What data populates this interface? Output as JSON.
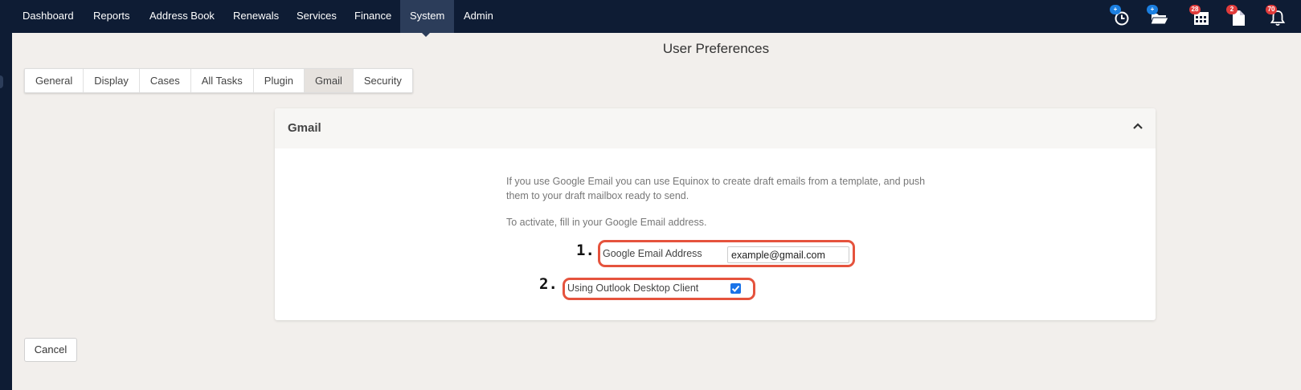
{
  "nav": {
    "items": [
      "Dashboard",
      "Reports",
      "Address Book",
      "Renewals",
      "Services",
      "Finance",
      "System",
      "Admin"
    ],
    "active": "System",
    "icons": [
      {
        "name": "add-timer-icon",
        "badge": "+",
        "badge_color": "#1b7fe0"
      },
      {
        "name": "add-folder-icon",
        "badge": "+",
        "badge_color": "#1b7fe0"
      },
      {
        "name": "calendar-icon",
        "badge": "28",
        "badge_color": "#e03b3b"
      },
      {
        "name": "document-icon",
        "badge": "2",
        "badge_color": "#e03b3b"
      },
      {
        "name": "bell-icon",
        "badge": "70",
        "badge_color": "#e03b3b"
      }
    ]
  },
  "page": {
    "title": "User Preferences"
  },
  "tabs": [
    "General",
    "Display",
    "Cases",
    "All Tasks",
    "Plugin",
    "Gmail",
    "Security"
  ],
  "active_tab": "Gmail",
  "panel": {
    "title": "Gmail",
    "description": "If you use Google Email you can use Equinox to create draft emails from a template, and push them to your draft mailbox ready to send.",
    "activate_text": "To activate, fill in your Google Email address.",
    "step1": "1.",
    "step2": "2.",
    "email_label": "Google Email Address",
    "email_value": "example@gmail.com",
    "outlook_label": "Using Outlook Desktop Client",
    "outlook_checked": true
  },
  "buttons": {
    "cancel": "Cancel"
  },
  "colors": {
    "nav_bg": "#0e1c34",
    "nav_active": "#2c3d5a",
    "highlight": "#e5533d",
    "checkbox": "#1a73e8"
  }
}
